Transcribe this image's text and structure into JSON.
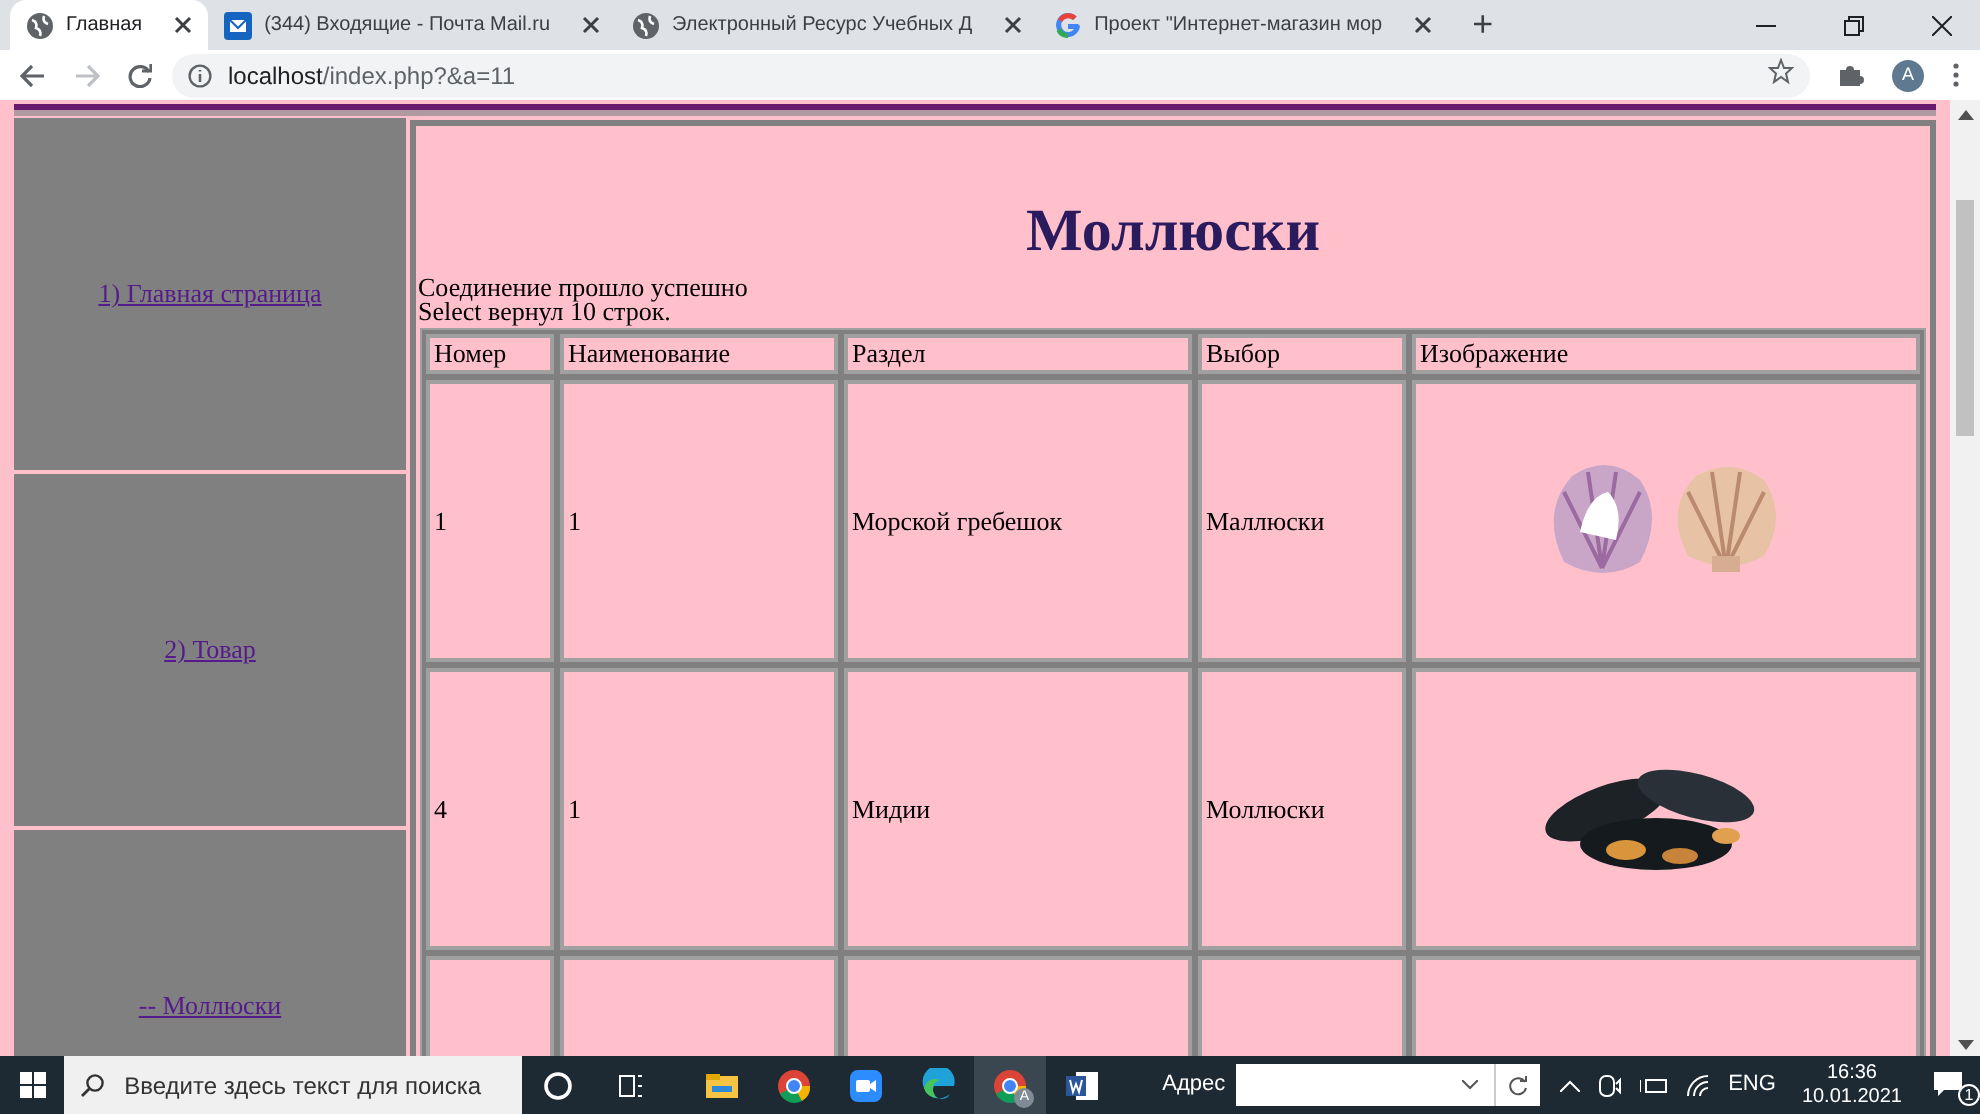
{
  "browser": {
    "tabs": [
      {
        "title": "Главная",
        "kind": "globe",
        "selected": true
      },
      {
        "title": "(344) Входящие - Почта Mail.ru",
        "kind": "mail",
        "selected": false
      },
      {
        "title": "Электронный Ресурс Учебных Д",
        "kind": "globe",
        "selected": false
      },
      {
        "title": "Проект \"Интернет-магазин мор",
        "kind": "g",
        "selected": false
      }
    ],
    "new_tab": "+",
    "url_host": "localhost",
    "url_path": "/index.php?&a=11",
    "profile": "A"
  },
  "sidebar": {
    "items": [
      {
        "label": "1) Главная страница"
      },
      {
        "label": "2) Товар"
      },
      {
        "label": "-- Моллюски"
      }
    ]
  },
  "main": {
    "heading": "Моллюски",
    "messages": [
      "Соединение прошло успешно",
      "Select вернул 10 строк."
    ],
    "table": {
      "columns": [
        "Номер",
        "Наименование",
        "Раздел",
        "Выбор",
        "Изображение"
      ],
      "rows": [
        {
          "cells": [
            "1",
            "1",
            "Морской гребешок",
            "Маллюски"
          ],
          "kind": "shells"
        },
        {
          "cells": [
            "4",
            "1",
            "Мидии",
            "Моллюски"
          ],
          "kind": "mussels"
        }
      ]
    }
  },
  "taskbar": {
    "search_placeholder": "Введите здесь текст для поиска",
    "address_label": "Адрес",
    "language": "ENG",
    "time": "16:36",
    "date": "10.01.2021",
    "notifications": "1",
    "avatar": "A"
  }
}
